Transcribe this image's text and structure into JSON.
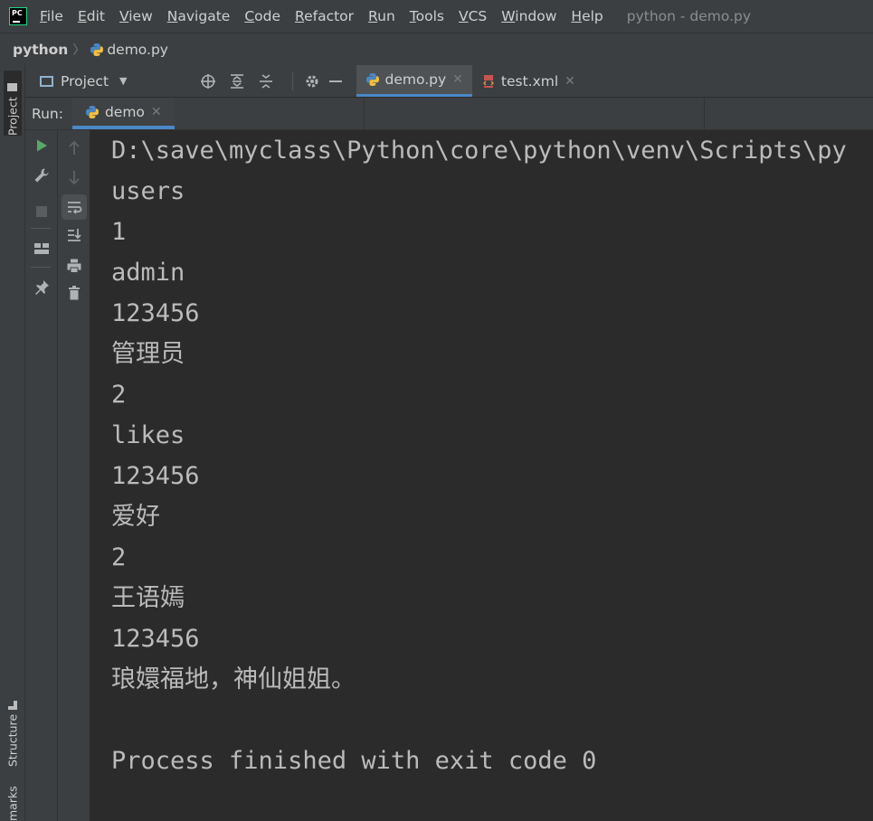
{
  "window": {
    "title": "python - demo.py"
  },
  "menu": [
    "File",
    "Edit",
    "View",
    "Navigate",
    "Code",
    "Refactor",
    "Run",
    "Tools",
    "VCS",
    "Window",
    "Help"
  ],
  "breadcrumb": {
    "project": "python",
    "file": "demo.py"
  },
  "side_tabs": {
    "project": "Project",
    "structure": "Structure",
    "bookmarks": "marks"
  },
  "project_panel": {
    "label": "Project"
  },
  "editor_tabs": [
    {
      "label": "demo.py",
      "active": true
    },
    {
      "label": "test.xml",
      "active": false
    }
  ],
  "run": {
    "label": "Run:",
    "tab": "demo"
  },
  "console": {
    "lines": [
      "D:\\save\\myclass\\Python\\core\\python\\venv\\Scripts\\py",
      "users",
      "1",
      "admin",
      "123456",
      "管理员",
      "2",
      "likes",
      "123456",
      "爱好",
      "2",
      "王语嫣",
      "123456",
      "琅嬛福地，神仙姐姐。",
      "",
      "Process finished with exit code 0"
    ]
  },
  "colors": {
    "accent": "#4a88c7",
    "run_green": "#59a869",
    "background": "#2b2b2b",
    "panel": "#3c3f41"
  }
}
